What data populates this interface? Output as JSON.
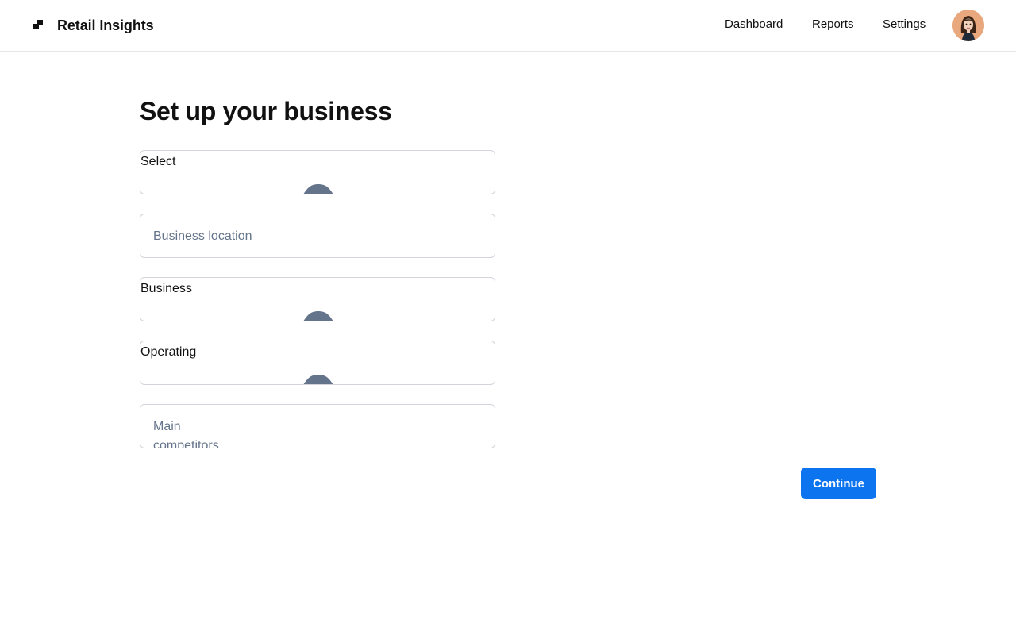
{
  "header": {
    "brand": "Retail Insights",
    "nav": [
      "Dashboard",
      "Reports",
      "Settings"
    ]
  },
  "page": {
    "title": "Set up your business"
  },
  "form": {
    "fields": [
      {
        "kind": "select",
        "label": "Select",
        "icon": "chevron-up-icon"
      },
      {
        "kind": "input",
        "placeholder": "Business location"
      },
      {
        "kind": "select",
        "label": "Business",
        "icon": "chevron-up-icon"
      },
      {
        "kind": "select",
        "label": "Operating",
        "icon": "chevron-up-icon"
      },
      {
        "kind": "input",
        "placeholder": "Main competitors"
      }
    ],
    "continue_label": "Continue"
  },
  "colors": {
    "primary": "#0d74f0",
    "chevron": "#64748b",
    "placeholder": "#64748b",
    "border": "#d1d5db"
  }
}
